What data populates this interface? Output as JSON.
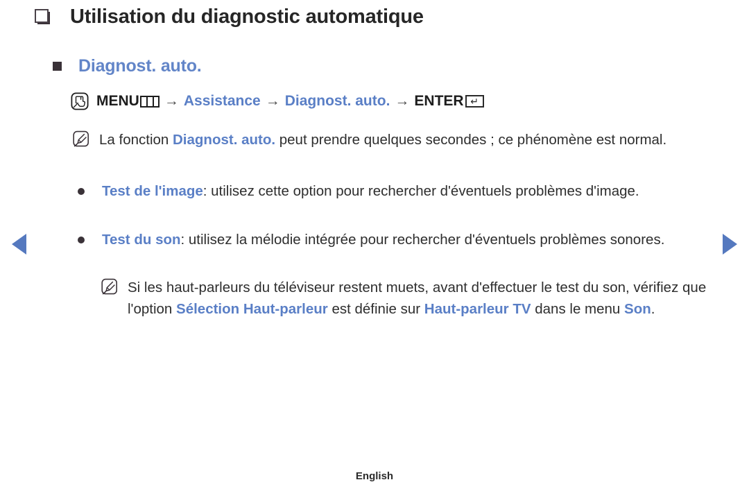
{
  "page": {
    "title": "Utilisation du diagnostic automatique",
    "subheading": "Diagnost. auto.",
    "footer_language": "English"
  },
  "icons": {
    "title_bullet": "square-outline-shadow-icon",
    "subheading_bullet": "filled-square-icon",
    "menu_path_icon": "hand-press-button-icon",
    "note_icon": "pencil-note-icon",
    "bullet_icon": "filled-disc-icon",
    "menu_glyph": "menu-grid-icon",
    "enter_glyph": "enter-return-icon",
    "nav_prev": "triangle-left-icon",
    "nav_next": "triangle-right-icon"
  },
  "colors": {
    "accent_blue": "#5a7fc6",
    "heading_blue": "#6285c8",
    "text_dark": "#2e2e2e",
    "nav_arrow": "#5579bf"
  },
  "menu_path": {
    "segments": [
      {
        "text": "MENU",
        "style": "dark-bold"
      },
      {
        "text": "menu-grid-icon",
        "style": "glyph"
      },
      {
        "text": "→",
        "style": "arrow"
      },
      {
        "text": "Assistance",
        "style": "blue-bold"
      },
      {
        "text": "→",
        "style": "arrow"
      },
      {
        "text": "Diagnost. auto.",
        "style": "blue-bold"
      },
      {
        "text": "→",
        "style": "arrow"
      },
      {
        "text": "ENTER",
        "style": "dark-bold"
      },
      {
        "text": "enter-return-icon",
        "style": "glyph"
      }
    ],
    "menu_label": "MENU",
    "assistance_label": "Assistance",
    "diagnost_label": "Diagnost. auto.",
    "enter_label": "ENTER",
    "arrow": "→",
    "enter_symbol": "↵"
  },
  "notes": [
    {
      "id": "note-auto-diagnosis-duration",
      "parts": [
        {
          "text": "La fonction ",
          "style": "plain"
        },
        {
          "text": "Diagnost. auto.",
          "style": "blue-bold"
        },
        {
          "text": " peut prendre quelques secondes ; ce phénomène est normal.",
          "style": "plain"
        }
      ]
    }
  ],
  "bullets": [
    {
      "id": "bullet-test-image",
      "parts": [
        {
          "text": "Test de l'image",
          "style": "blue-bold"
        },
        {
          "text": ": utilisez cette option pour rechercher d'éventuels problèmes d'image.",
          "style": "plain"
        }
      ]
    },
    {
      "id": "bullet-test-son",
      "parts": [
        {
          "text": "Test du son",
          "style": "blue-bold"
        },
        {
          "text": ": utilisez la mélodie intégrée pour rechercher d'éventuels problèmes sonores.",
          "style": "plain"
        }
      ]
    }
  ],
  "subnotes": [
    {
      "id": "subnote-speaker-select",
      "parts": [
        {
          "text": "Si les haut-parleurs du téléviseur restent muets, avant d'effectuer le test du son, vérifiez que l'option ",
          "style": "plain"
        },
        {
          "text": "Sélection Haut-parleur",
          "style": "blue-bold"
        },
        {
          "text": " est définie sur ",
          "style": "plain"
        },
        {
          "text": "Haut-parleur TV",
          "style": "blue-bold"
        },
        {
          "text": " dans le menu ",
          "style": "plain"
        },
        {
          "text": "Son",
          "style": "blue-bold"
        },
        {
          "text": ".",
          "style": "plain"
        }
      ]
    }
  ]
}
